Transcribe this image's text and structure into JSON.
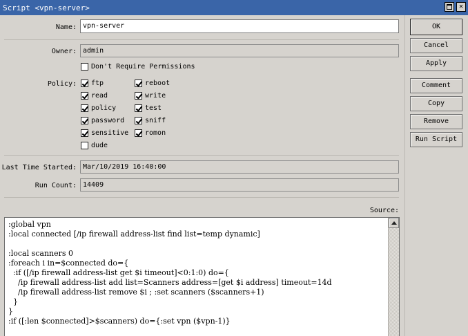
{
  "window": {
    "title": "Script <vpn-server>"
  },
  "form": {
    "name_label": "Name:",
    "name_value": "vpn-server",
    "owner_label": "Owner:",
    "owner_value": "admin",
    "dont_require_permissions_label": "Don't Require Permissions",
    "dont_require_permissions_checked": false,
    "policy_label": "Policy:",
    "policies": [
      {
        "label": "ftp",
        "checked": true
      },
      {
        "label": "reboot",
        "checked": true
      },
      {
        "label": "read",
        "checked": true
      },
      {
        "label": "write",
        "checked": true
      },
      {
        "label": "policy",
        "checked": true
      },
      {
        "label": "test",
        "checked": true
      },
      {
        "label": "password",
        "checked": true
      },
      {
        "label": "sniff",
        "checked": true
      },
      {
        "label": "sensitive",
        "checked": true
      },
      {
        "label": "romon",
        "checked": true
      },
      {
        "label": "dude",
        "checked": false
      }
    ],
    "last_started_label": "Last Time Started:",
    "last_started_value": "Mar/10/2019 16:40:00",
    "run_count_label": "Run Count:",
    "run_count_value": "14409",
    "source_label": "Source:"
  },
  "buttons": {
    "ok": "OK",
    "cancel": "Cancel",
    "apply": "Apply",
    "comment": "Comment",
    "copy": "Copy",
    "remove": "Remove",
    "run_script": "Run Script"
  },
  "source_lines": [
    ":global vpn",
    ":local connected [/ip firewall address-list find list=temp dynamic]",
    "",
    ":local scanners 0",
    ":foreach i in=$connected do={",
    "  :if ([/ip firewall address-list get $i timeout]<0:1:0) do={",
    "    /ip firewall address-list add list=Scanners address=[get $i address] timeout=14d",
    "    /ip firewall address-list remove $i ; :set scanners ($scanners+1)",
    "  }",
    "}",
    ":if ([:len $connected]>$scanners) do={:set vpn ($vpn-1)}"
  ]
}
